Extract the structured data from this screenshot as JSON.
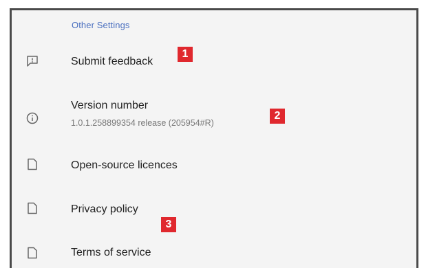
{
  "section": {
    "header": "Other Settings"
  },
  "rows": [
    {
      "title": "Submit feedback",
      "icon": "feedback-icon"
    },
    {
      "title": "Version number",
      "subtitle": "1.0.1.258899354 release (205954#R)",
      "icon": "info-icon"
    },
    {
      "title": "Open-source licences",
      "icon": "document-icon"
    },
    {
      "title": "Privacy policy",
      "icon": "document-icon"
    },
    {
      "title": "Terms of service",
      "icon": "document-icon"
    }
  ],
  "badges": [
    "1",
    "2",
    "3"
  ],
  "colors": {
    "header": "#4a6fbf",
    "badge": "#e0282e",
    "frame": "#4a4a4a"
  }
}
